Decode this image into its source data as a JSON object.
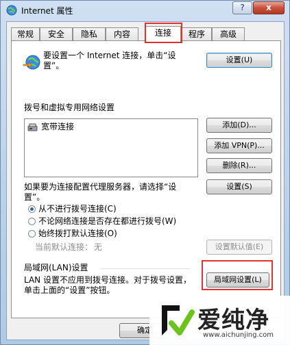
{
  "window": {
    "title": "Internet 属性",
    "help_label": "?",
    "close_label": "x"
  },
  "tabs": [
    {
      "label": "常规"
    },
    {
      "label": "安全"
    },
    {
      "label": "隐私"
    },
    {
      "label": "内容"
    },
    {
      "label": "连接",
      "active": true
    },
    {
      "label": "程序"
    },
    {
      "label": "高级"
    }
  ],
  "setup": {
    "text": "要设置一个 Internet 连接，单击“设置”。",
    "button": "设置(U)"
  },
  "dialup": {
    "section_title": "拨号和虚拟专用网络设置",
    "connections": [
      "宽带连接"
    ],
    "add_button": "添加(D)...",
    "add_vpn_button": "添加 VPN(P)...",
    "remove_button": "删除(R)...",
    "proxy_text": "如果要为连接配置代理服务器，请选择“设置”。",
    "settings_button": "设置(S)",
    "options": [
      {
        "label": "从不进行拨号连接(C)",
        "checked": true
      },
      {
        "label": "不论网络连接是否存在都进行拨号(W)",
        "checked": false
      },
      {
        "label": "始终拨打默认连接(O)",
        "checked": false
      }
    ],
    "current_default_label": "当前默认连接：",
    "current_default_value": "无",
    "set_default_button": "设置默认值(E)"
  },
  "lan": {
    "section_title": "局域网(LAN)设置",
    "text": "LAN 设置不应用到拨号连接。对于拨号设置，单击上面的“设置”按钮。",
    "button": "局域网设置(L)"
  },
  "footer": {
    "ok_button": "确定"
  },
  "watermark": {
    "name": "爱纯净",
    "url": "www.aichunjing.com"
  },
  "colors": {
    "highlight": "#e03030",
    "accent": "#3c7fb1"
  }
}
